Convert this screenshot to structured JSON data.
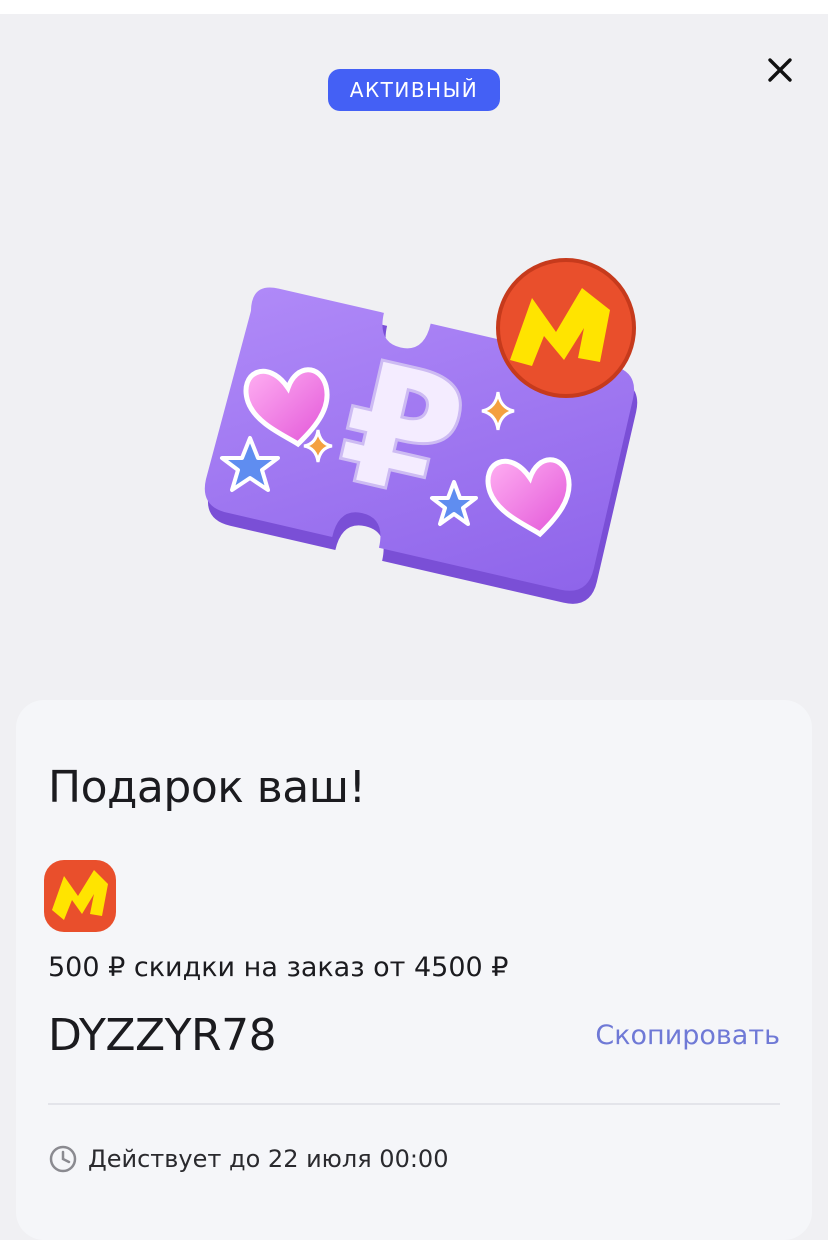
{
  "status": {
    "badge_label": "АКТИВНЫЙ",
    "badge_color": "#4460f5"
  },
  "header": {
    "close_icon": "close-icon"
  },
  "hero": {
    "image": "coupon-illustration",
    "currency_symbol": "₽"
  },
  "card": {
    "title": "Подарок ваш!",
    "logo_icon": "market-logo-icon",
    "discount_text": "500 ₽ скидки на заказ от 4500 ₽",
    "promo_code": "DYZZYR78",
    "copy_label": "Скопировать",
    "validity_icon": "clock-icon",
    "validity_text": "Действует до 22 июля 00:00"
  },
  "colors": {
    "accent": "#4460f5",
    "link": "#6f79d6",
    "ticket_purple": "#9a6ff0",
    "logo_red": "#e94f2c",
    "logo_yellow": "#ffe400"
  }
}
